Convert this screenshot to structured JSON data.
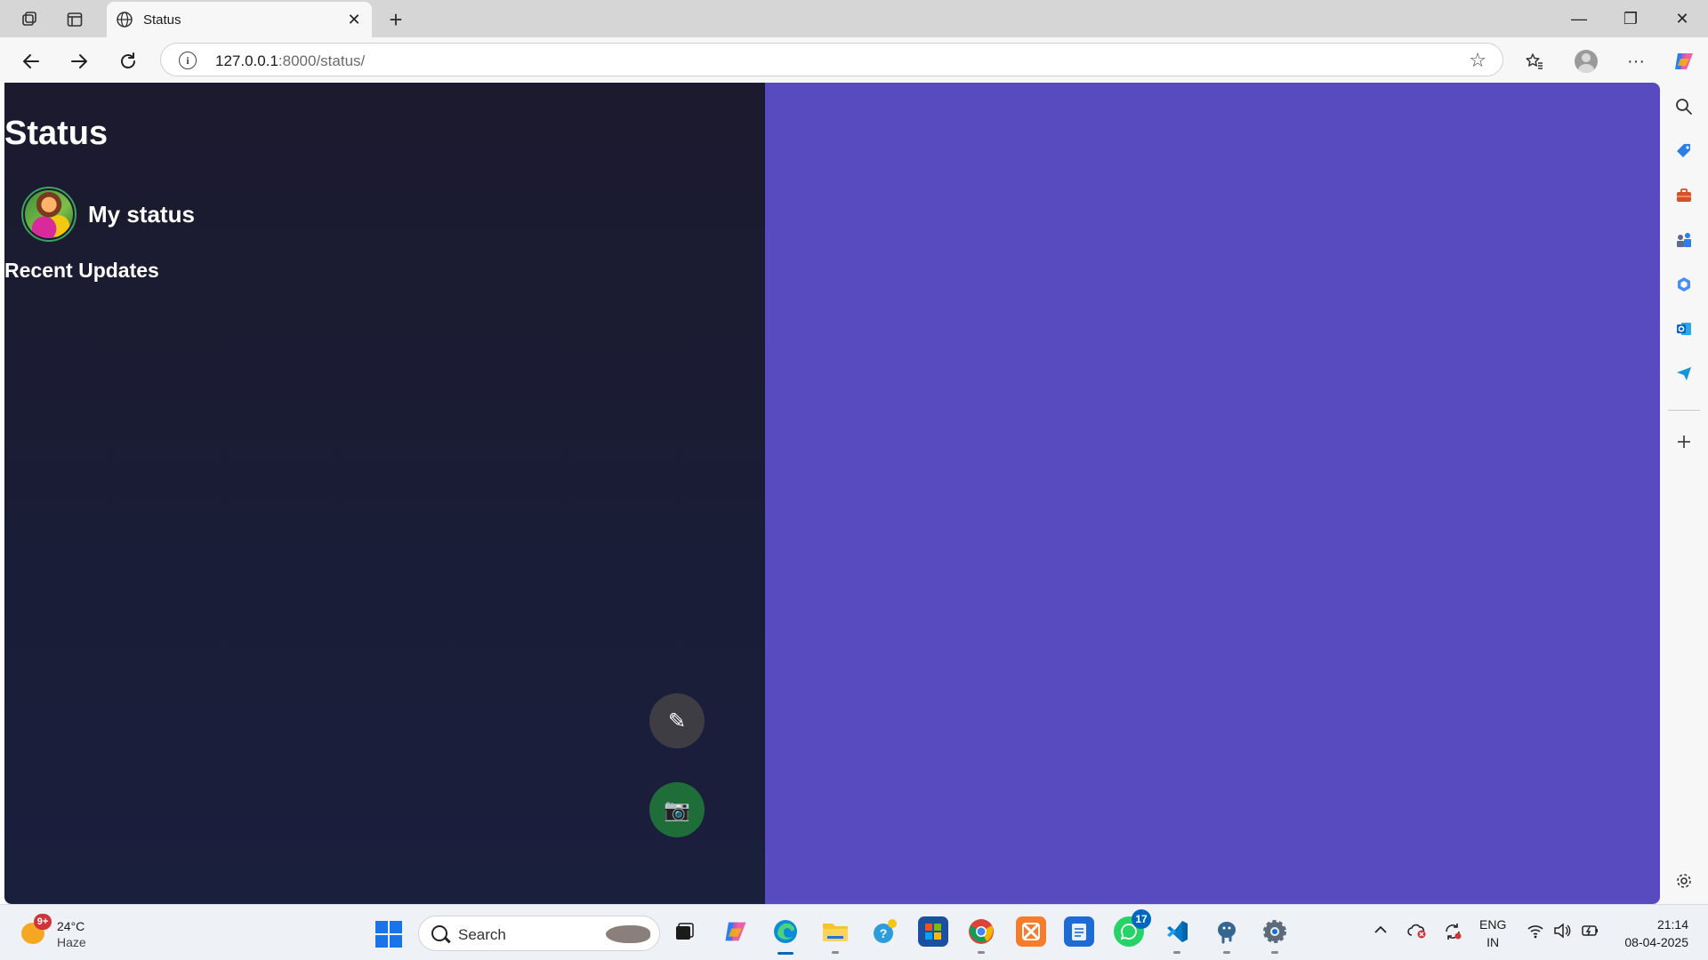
{
  "browser": {
    "tab_title": "Status",
    "address_host": "127.0.0.1",
    "address_path": ":8000/status/",
    "new_tab_symbol": "+",
    "close_symbol": "✕",
    "window_controls": {
      "minimize": "—",
      "restore": "❐",
      "close": "✕"
    }
  },
  "page": {
    "title": "Status",
    "my_status_label": "My status",
    "recent_updates_label": "Recent Updates",
    "fab_edit_icon": "✎",
    "fab_camera_icon": "📷",
    "colors": {
      "left_pane": "#1b1a2e",
      "right_pane": "#574bbf",
      "fab_edit": "#3d3d43",
      "fab_camera": "#1f6e3a",
      "avatar_ring": "#3aa35c"
    }
  },
  "taskbar": {
    "weather_temp": "24°C",
    "weather_condition": "Haze",
    "weather_badge": "9+",
    "search_placeholder": "Search",
    "whatsapp_badge": "17",
    "language_line1": "ENG",
    "language_line2": "IN",
    "time": "21:14",
    "date": "08-04-2025"
  }
}
